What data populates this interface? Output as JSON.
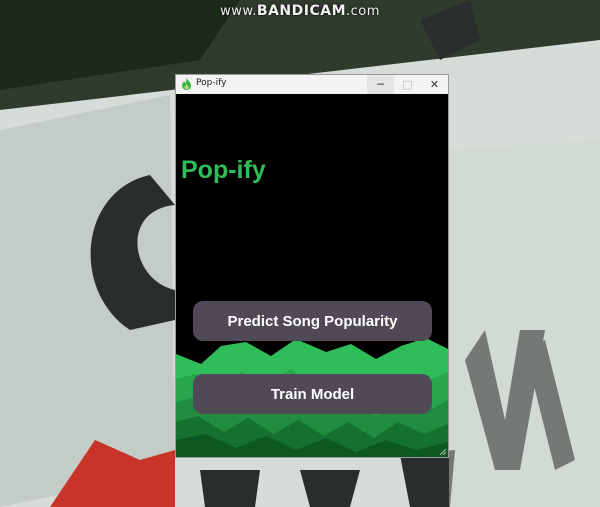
{
  "watermark": {
    "prefix": "www.",
    "brand": "BANDICAM",
    "suffix": ".com"
  },
  "window": {
    "title": "Pop-ify",
    "icon": "flame-icon",
    "controls": {
      "minimize": "─",
      "maximize": "□",
      "close": "✕"
    }
  },
  "app": {
    "heading": "Pop-ify",
    "buttons": {
      "predict": "Predict Song Popularity",
      "train": "Train Model"
    }
  },
  "colors": {
    "accent_green": "#2fbd59",
    "button_bg": "#4f4a55",
    "background": "#000000"
  }
}
